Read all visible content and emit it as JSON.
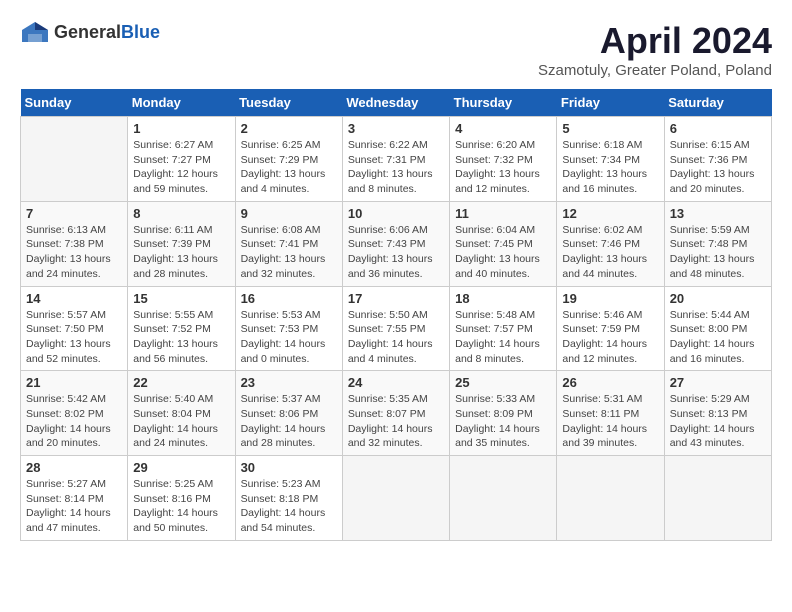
{
  "header": {
    "logo_general": "General",
    "logo_blue": "Blue",
    "title": "April 2024",
    "subtitle": "Szamotuly, Greater Poland, Poland"
  },
  "calendar": {
    "days_of_week": [
      "Sunday",
      "Monday",
      "Tuesday",
      "Wednesday",
      "Thursday",
      "Friday",
      "Saturday"
    ],
    "weeks": [
      [
        {
          "day": "",
          "info": ""
        },
        {
          "day": "1",
          "info": "Sunrise: 6:27 AM\nSunset: 7:27 PM\nDaylight: 12 hours\nand 59 minutes."
        },
        {
          "day": "2",
          "info": "Sunrise: 6:25 AM\nSunset: 7:29 PM\nDaylight: 13 hours\nand 4 minutes."
        },
        {
          "day": "3",
          "info": "Sunrise: 6:22 AM\nSunset: 7:31 PM\nDaylight: 13 hours\nand 8 minutes."
        },
        {
          "day": "4",
          "info": "Sunrise: 6:20 AM\nSunset: 7:32 PM\nDaylight: 13 hours\nand 12 minutes."
        },
        {
          "day": "5",
          "info": "Sunrise: 6:18 AM\nSunset: 7:34 PM\nDaylight: 13 hours\nand 16 minutes."
        },
        {
          "day": "6",
          "info": "Sunrise: 6:15 AM\nSunset: 7:36 PM\nDaylight: 13 hours\nand 20 minutes."
        }
      ],
      [
        {
          "day": "7",
          "info": "Sunrise: 6:13 AM\nSunset: 7:38 PM\nDaylight: 13 hours\nand 24 minutes."
        },
        {
          "day": "8",
          "info": "Sunrise: 6:11 AM\nSunset: 7:39 PM\nDaylight: 13 hours\nand 28 minutes."
        },
        {
          "day": "9",
          "info": "Sunrise: 6:08 AM\nSunset: 7:41 PM\nDaylight: 13 hours\nand 32 minutes."
        },
        {
          "day": "10",
          "info": "Sunrise: 6:06 AM\nSunset: 7:43 PM\nDaylight: 13 hours\nand 36 minutes."
        },
        {
          "day": "11",
          "info": "Sunrise: 6:04 AM\nSunset: 7:45 PM\nDaylight: 13 hours\nand 40 minutes."
        },
        {
          "day": "12",
          "info": "Sunrise: 6:02 AM\nSunset: 7:46 PM\nDaylight: 13 hours\nand 44 minutes."
        },
        {
          "day": "13",
          "info": "Sunrise: 5:59 AM\nSunset: 7:48 PM\nDaylight: 13 hours\nand 48 minutes."
        }
      ],
      [
        {
          "day": "14",
          "info": "Sunrise: 5:57 AM\nSunset: 7:50 PM\nDaylight: 13 hours\nand 52 minutes."
        },
        {
          "day": "15",
          "info": "Sunrise: 5:55 AM\nSunset: 7:52 PM\nDaylight: 13 hours\nand 56 minutes."
        },
        {
          "day": "16",
          "info": "Sunrise: 5:53 AM\nSunset: 7:53 PM\nDaylight: 14 hours\nand 0 minutes."
        },
        {
          "day": "17",
          "info": "Sunrise: 5:50 AM\nSunset: 7:55 PM\nDaylight: 14 hours\nand 4 minutes."
        },
        {
          "day": "18",
          "info": "Sunrise: 5:48 AM\nSunset: 7:57 PM\nDaylight: 14 hours\nand 8 minutes."
        },
        {
          "day": "19",
          "info": "Sunrise: 5:46 AM\nSunset: 7:59 PM\nDaylight: 14 hours\nand 12 minutes."
        },
        {
          "day": "20",
          "info": "Sunrise: 5:44 AM\nSunset: 8:00 PM\nDaylight: 14 hours\nand 16 minutes."
        }
      ],
      [
        {
          "day": "21",
          "info": "Sunrise: 5:42 AM\nSunset: 8:02 PM\nDaylight: 14 hours\nand 20 minutes."
        },
        {
          "day": "22",
          "info": "Sunrise: 5:40 AM\nSunset: 8:04 PM\nDaylight: 14 hours\nand 24 minutes."
        },
        {
          "day": "23",
          "info": "Sunrise: 5:37 AM\nSunset: 8:06 PM\nDaylight: 14 hours\nand 28 minutes."
        },
        {
          "day": "24",
          "info": "Sunrise: 5:35 AM\nSunset: 8:07 PM\nDaylight: 14 hours\nand 32 minutes."
        },
        {
          "day": "25",
          "info": "Sunrise: 5:33 AM\nSunset: 8:09 PM\nDaylight: 14 hours\nand 35 minutes."
        },
        {
          "day": "26",
          "info": "Sunrise: 5:31 AM\nSunset: 8:11 PM\nDaylight: 14 hours\nand 39 minutes."
        },
        {
          "day": "27",
          "info": "Sunrise: 5:29 AM\nSunset: 8:13 PM\nDaylight: 14 hours\nand 43 minutes."
        }
      ],
      [
        {
          "day": "28",
          "info": "Sunrise: 5:27 AM\nSunset: 8:14 PM\nDaylight: 14 hours\nand 47 minutes."
        },
        {
          "day": "29",
          "info": "Sunrise: 5:25 AM\nSunset: 8:16 PM\nDaylight: 14 hours\nand 50 minutes."
        },
        {
          "day": "30",
          "info": "Sunrise: 5:23 AM\nSunset: 8:18 PM\nDaylight: 14 hours\nand 54 minutes."
        },
        {
          "day": "",
          "info": ""
        },
        {
          "day": "",
          "info": ""
        },
        {
          "day": "",
          "info": ""
        },
        {
          "day": "",
          "info": ""
        }
      ]
    ]
  }
}
